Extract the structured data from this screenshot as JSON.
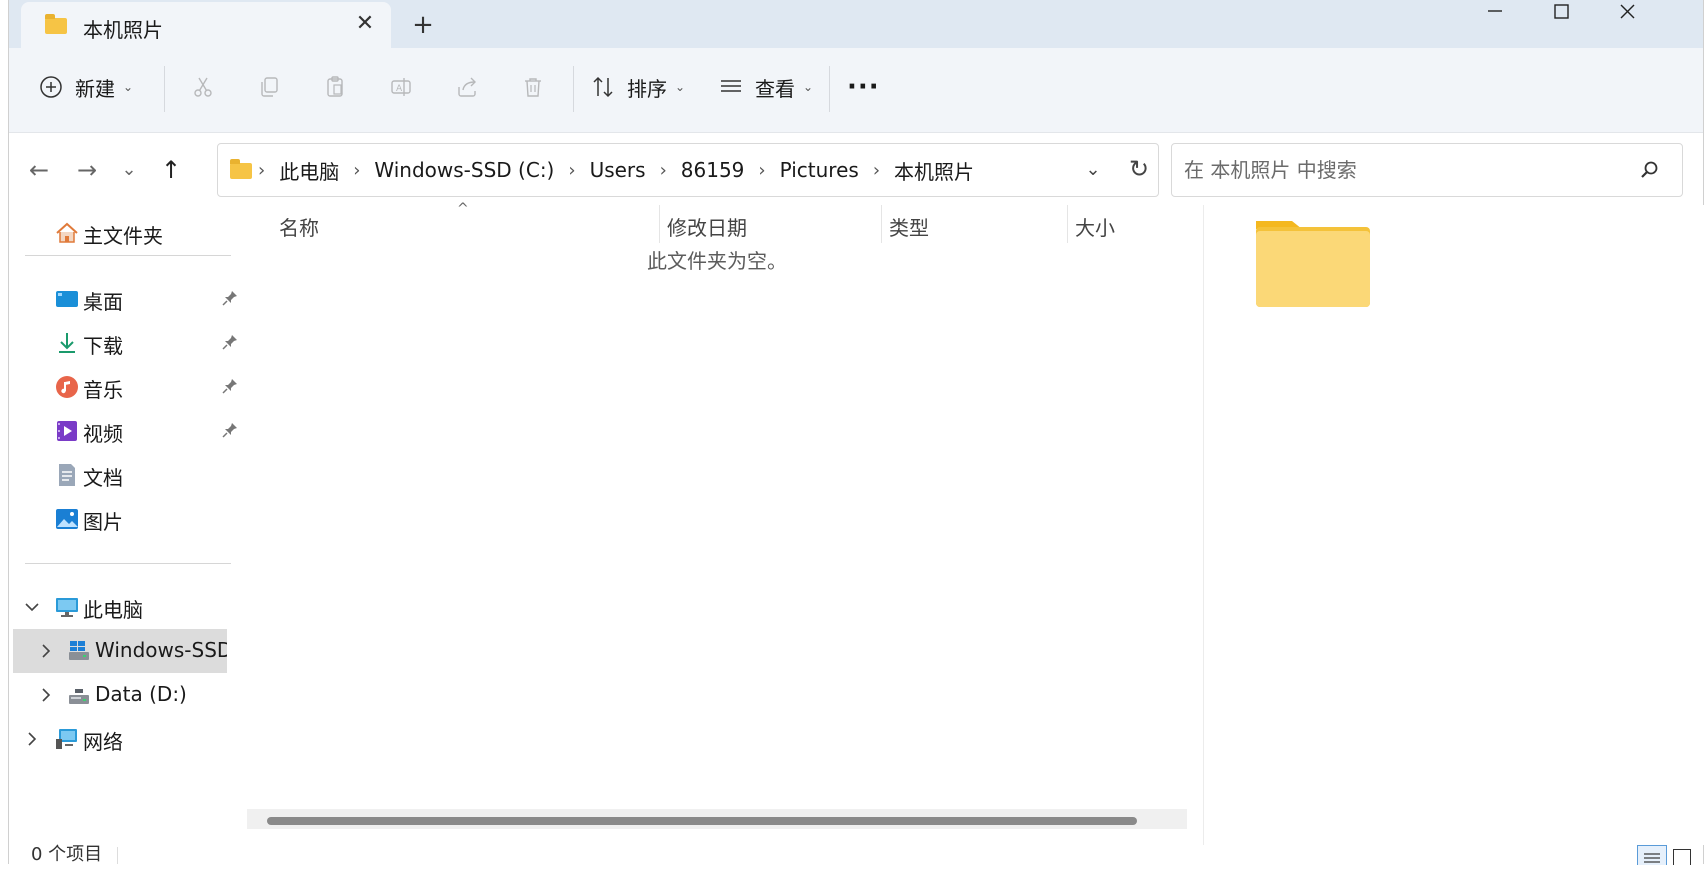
{
  "window": {
    "tab_title": "本机照片",
    "tab_close": "✕",
    "new_tab": "+",
    "minimize": "—",
    "maximize": "☐",
    "close": "✕"
  },
  "toolbar": {
    "new_label": "新建",
    "sort_label": "排序",
    "view_label": "查看",
    "more_label": "···",
    "caret": "⌄"
  },
  "nav": {
    "back": "←",
    "forward": "→",
    "recent": "⌄",
    "up": "↑"
  },
  "address": {
    "crumbs": [
      "此电脑",
      "Windows-SSD (C:)",
      "Users",
      "86159",
      "Pictures",
      "本机照片"
    ],
    "separator": "›",
    "dropdown": "⌄",
    "refresh": "↻"
  },
  "search": {
    "placeholder": "在 本机照片 中搜索"
  },
  "sidebar": {
    "home": "主文件夹",
    "quick": [
      {
        "label": "桌面",
        "icon": "desktop-icon"
      },
      {
        "label": "下载",
        "icon": "download-icon"
      },
      {
        "label": "音乐",
        "icon": "music-icon"
      },
      {
        "label": "视频",
        "icon": "video-icon"
      },
      {
        "label": "文档",
        "icon": "document-icon"
      },
      {
        "label": "图片",
        "icon": "pictures-icon"
      }
    ],
    "this_pc": "此电脑",
    "drive_c": "Windows-SSD (C:)",
    "drive_d": "Data (D:)",
    "network": "网络",
    "chevron_right": "›",
    "chevron_down": "⌄"
  },
  "list": {
    "columns": [
      "名称",
      "修改日期",
      "类型",
      "大小"
    ],
    "sort_indicator": "^",
    "empty_message": "此文件夹为空。"
  },
  "status": {
    "item_count": "0 个项目"
  },
  "colors": {
    "titlebar": "#dfe8f2",
    "toolbar": "#f2f5f9",
    "folder": "#f6c445",
    "selected": "#dcdcdc"
  }
}
